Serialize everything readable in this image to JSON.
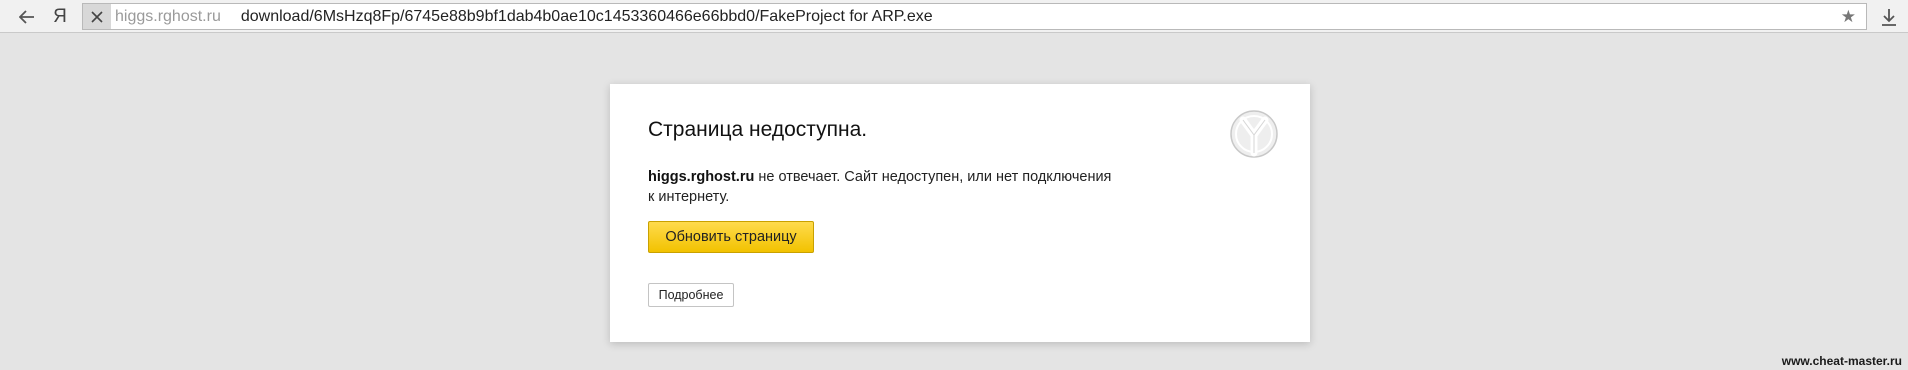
{
  "toolbar": {
    "logo_text": "Я",
    "back_icon": "arrow-left-icon",
    "stop_icon": "close-icon",
    "star_icon": "star-icon",
    "download_icon": "download-icon"
  },
  "address_bar": {
    "host": "higgs.rghost.ru",
    "path": "download/6MsHzq8Fp/6745e88b9bf1dab4b0ae10c1453360466e66bbd0/FakeProject for ARP.exe"
  },
  "error_page": {
    "title": "Страница недоступна.",
    "host_bold": "higgs.rghost.ru",
    "message_line1": " не отвечает. Сайт недоступен, или нет подключения",
    "message_line2": "к интернету.",
    "reload_label": "Обновить страницу",
    "details_label": "Подробнее",
    "accent_color": "#ffd633"
  },
  "watermark": "www.cheat-master.ru"
}
